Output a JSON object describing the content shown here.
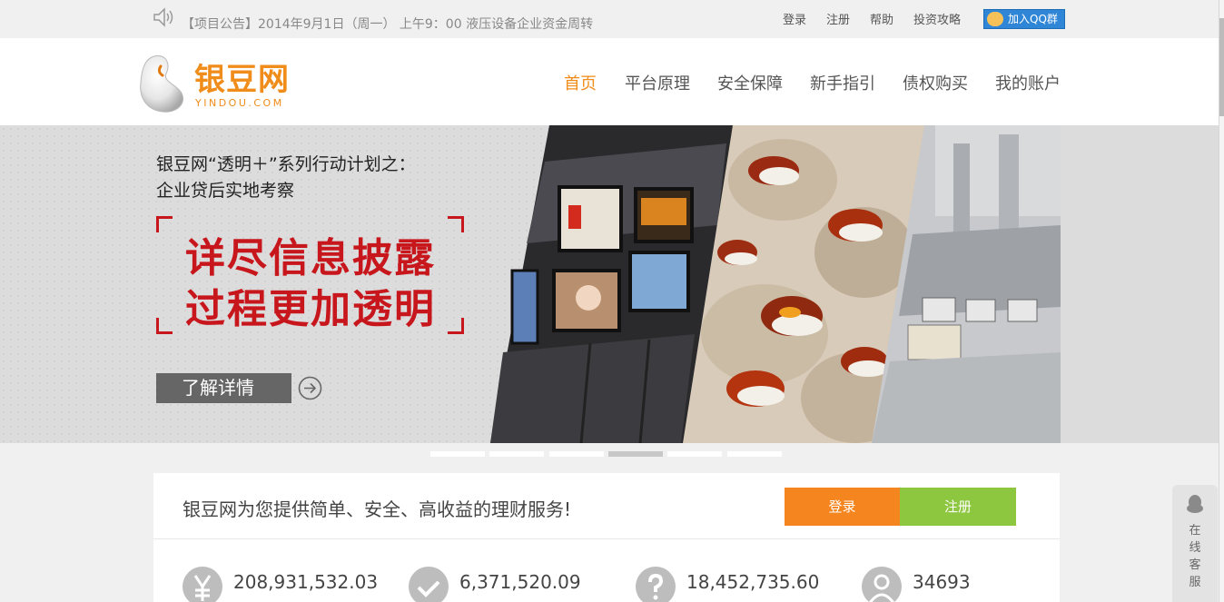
{
  "topbar": {
    "notice": "【项目公告】2014年9月1日（周一） 上午9：00 液压设备企业资金周转",
    "links": [
      "登录",
      "注册",
      "帮助",
      "投资攻略"
    ],
    "qq_label": "加入QQ群"
  },
  "header": {
    "logo_cn": "银豆网",
    "logo_en": "YINDOU.COM",
    "nav": [
      "首页",
      "平台原理",
      "安全保障",
      "新手指引",
      "债权购买",
      "我的账户"
    ],
    "active_nav": "首页"
  },
  "banner": {
    "title_line1": "银豆网“透明＋”系列行动计划之：",
    "title_line2": "企业贷后实地考察",
    "headline_line1": "详尽信息披露",
    "headline_line2": "过程更加透明",
    "cta": "了解详情",
    "slide_count": 6,
    "active_slide": 4
  },
  "account": {
    "slogan": "银豆网为您提供简单、安全、高收益的理财服务!",
    "login_label": "登录",
    "register_label": "注册"
  },
  "stats": [
    "208,931,532.03",
    "6,371,520.09",
    "18,452,735.60",
    "34693"
  ],
  "service": {
    "label": [
      "在",
      "线",
      "客",
      "服"
    ]
  },
  "colors": {
    "brand_orange": "#f08c1a",
    "headline_red": "#c8161d",
    "register_green": "#8dc63f"
  }
}
